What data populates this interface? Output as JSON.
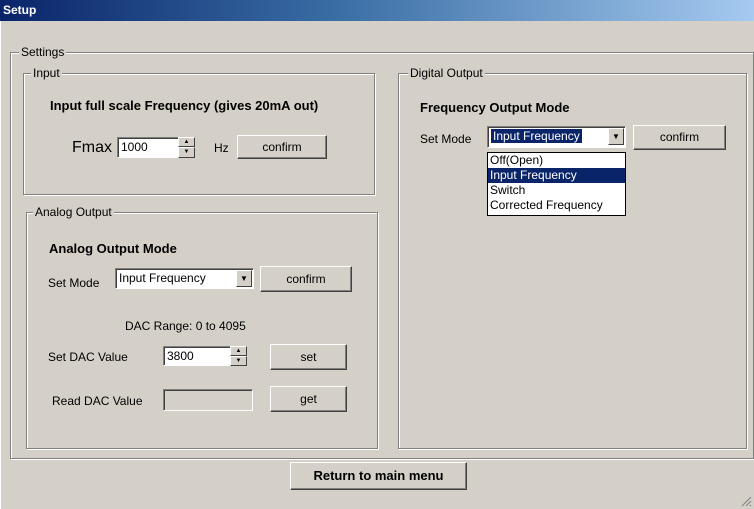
{
  "window": {
    "title": "Setup"
  },
  "settings": {
    "legend": "Settings"
  },
  "input": {
    "legend": "Input",
    "heading": "Input full scale Frequency (gives 20mA out)",
    "fmax_label": "Fmax",
    "fmax_value": "1000",
    "unit": "Hz",
    "confirm_label": "confirm"
  },
  "analog": {
    "legend": "Analog Output",
    "heading": "Analog Output Mode",
    "set_mode_label": "Set Mode",
    "mode_value": "Input Frequency",
    "confirm_label": "confirm",
    "dac_range": "DAC Range: 0 to 4095",
    "set_dac_label": "Set DAC Value",
    "set_dac_value": "3800",
    "set_label": "set",
    "read_dac_label": "Read DAC Value",
    "read_dac_value": "",
    "get_label": "get"
  },
  "digital": {
    "legend": "Digital Output",
    "heading": "Frequency Output Mode",
    "set_mode_label": "Set Mode",
    "mode_value": "Input Frequency",
    "confirm_label": "confirm",
    "options": [
      "Off(Open)",
      "Input Frequency",
      "Switch",
      "Corrected Frequency"
    ]
  },
  "footer": {
    "return_label": "Return to main menu"
  },
  "colors": {
    "face": "#d4d0c8",
    "title_start": "#0a246a",
    "selection": "#0a246a"
  },
  "icons": {
    "spin_up": "up-arrow-icon",
    "spin_down": "down-arrow-icon",
    "dropdown": "chevron-down-icon",
    "resize": "resize-grip-icon"
  }
}
